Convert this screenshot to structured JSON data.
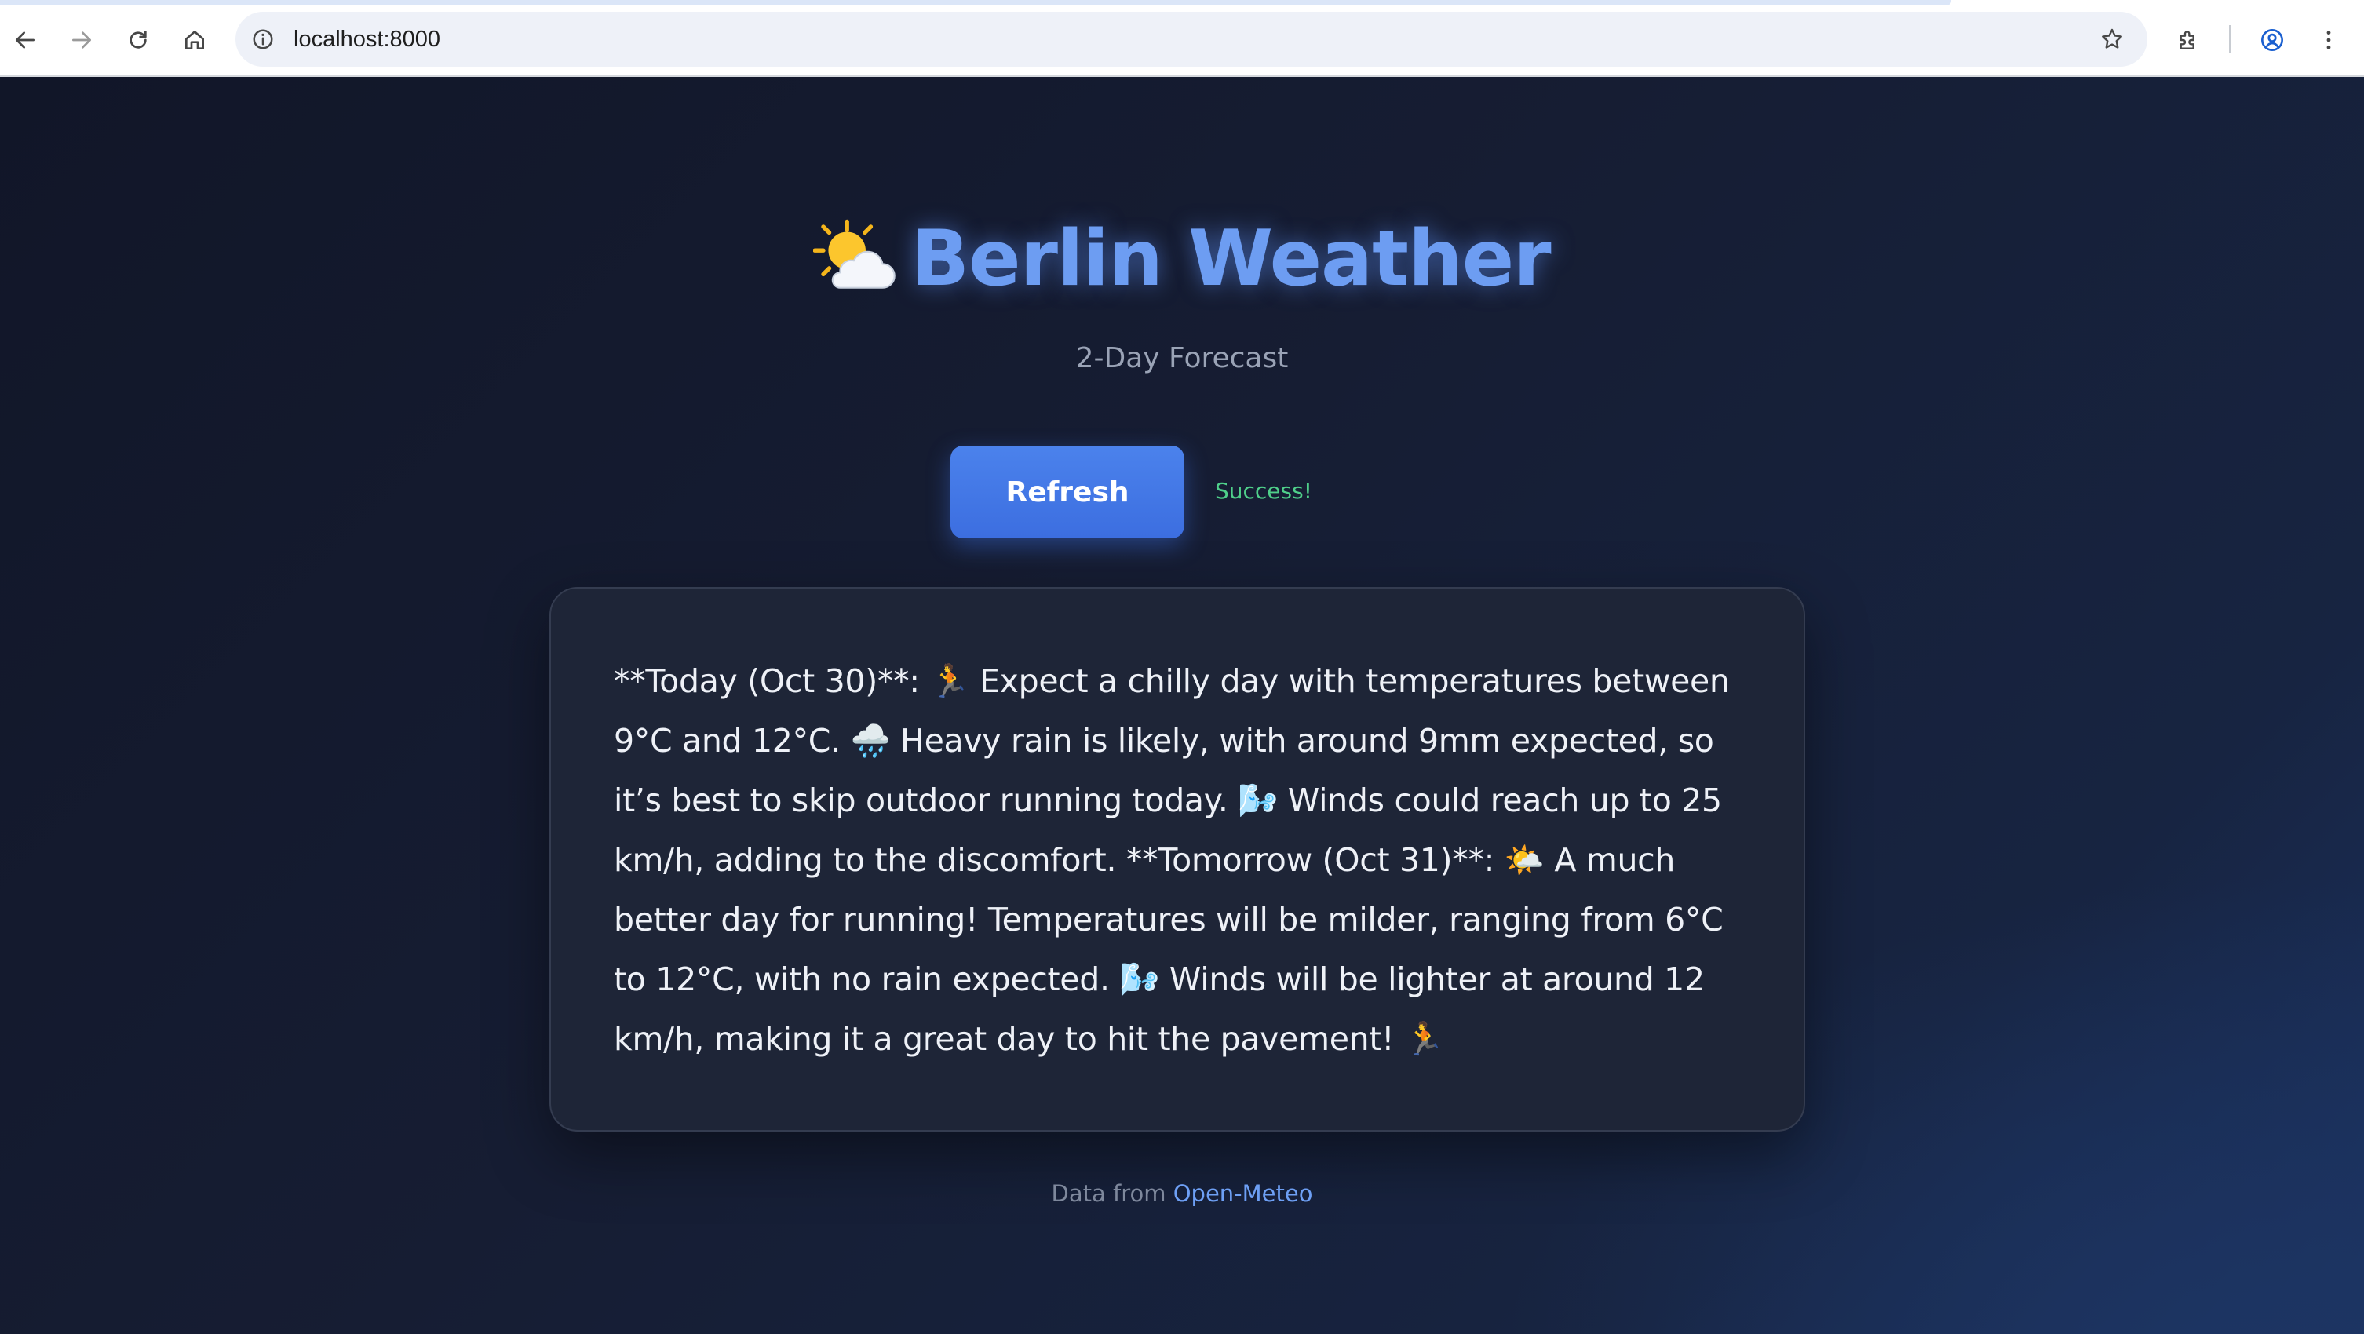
{
  "browser": {
    "url": "localhost:8000"
  },
  "header": {
    "title_icon": "sun-behind-cloud-icon",
    "title": "Berlin Weather",
    "subtitle": "2-Day Forecast"
  },
  "controls": {
    "refresh_label": "Refresh",
    "status_text": "Success!"
  },
  "forecast": {
    "text": "**Today (Oct 30)**: 🏃 Expect a chilly day with temperatures between 9°C and 12°C. 🌧️ Heavy rain is likely, with around 9mm expected, so it’s best to skip outdoor running today. 🌬️ Winds could reach up to 25 km/h, adding to the discomfort. **Tomorrow (Oct 31)**: 🌤️ A much better day for running! Temperatures will be milder, ranging from 6°C to 12°C, with no rain expected. 🌬️ Winds will be lighter at around 12 km/h, making it a great day to hit the pavement! 🏃"
  },
  "footer": {
    "prefix": "Data from",
    "link_label": "Open-Meteo"
  },
  "colors": {
    "accent": "#6d9df2",
    "button": "#3c6ee0",
    "success": "#4fcf8a",
    "card": "#1e2537"
  }
}
